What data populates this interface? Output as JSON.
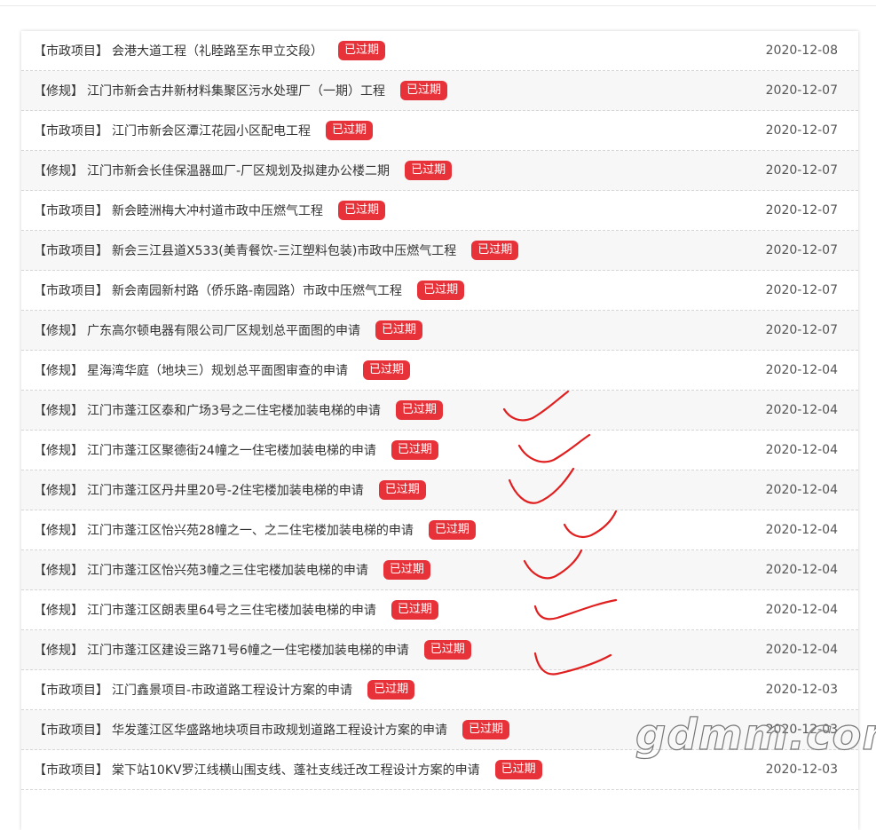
{
  "status_badge": "已过期",
  "watermark_text": "gdmm.com",
  "rows": [
    {
      "category": "【市政项目】",
      "title": "会港大道工程（礼睦路至东甲立交段）",
      "date": "2020-12-08"
    },
    {
      "category": "【修规】",
      "title": "江门市新会古井新材料集聚区污水处理厂（一期）工程",
      "date": "2020-12-07"
    },
    {
      "category": "【市政项目】",
      "title": "江门市新会区潭江花园小区配电工程",
      "date": "2020-12-07"
    },
    {
      "category": "【修规】",
      "title": "江门市新会长佳保温器皿厂-厂区规划及拟建办公楼二期",
      "date": "2020-12-07"
    },
    {
      "category": "【市政项目】",
      "title": "新会睦洲梅大冲村道市政中压燃气工程",
      "date": "2020-12-07"
    },
    {
      "category": "【市政项目】",
      "title": "新会三江县道X533(美青餐饮-三江塑料包装)市政中压燃气工程",
      "date": "2020-12-07"
    },
    {
      "category": "【市政项目】",
      "title": "新会南园新村路（侨乐路-南园路）市政中压燃气工程",
      "date": "2020-12-07"
    },
    {
      "category": "【修规】",
      "title": "广东高尔顿电器有限公司厂区规划总平面图的申请",
      "date": "2020-12-07"
    },
    {
      "category": "【修规】",
      "title": "星海湾华庭（地块三）规划总平面图审查的申请",
      "date": "2020-12-04"
    },
    {
      "category": "【修规】",
      "title": "江门市蓬江区泰和广场3号之二住宅楼加装电梯的申请",
      "date": "2020-12-04"
    },
    {
      "category": "【修规】",
      "title": "江门市蓬江区聚德街24幢之一住宅楼加装电梯的申请",
      "date": "2020-12-04"
    },
    {
      "category": "【修规】",
      "title": "江门市蓬江区丹井里20号-2住宅楼加装电梯的申请",
      "date": "2020-12-04"
    },
    {
      "category": "【修规】",
      "title": "江门市蓬江区怡兴苑28幢之一、之二住宅楼加装电梯的申请",
      "date": "2020-12-04"
    },
    {
      "category": "【修规】",
      "title": "江门市蓬江区怡兴苑3幢之三住宅楼加装电梯的申请",
      "date": "2020-12-04"
    },
    {
      "category": "【修规】",
      "title": "江门市蓬江区朗表里64号之三住宅楼加装电梯的申请",
      "date": "2020-12-04"
    },
    {
      "category": "【修规】",
      "title": "江门市蓬江区建设三路71号6幢之一住宅楼加装电梯的申请",
      "date": "2020-12-04"
    },
    {
      "category": "【市政项目】",
      "title": "江门鑫景项目-市政道路工程设计方案的申请",
      "date": "2020-12-03"
    },
    {
      "category": "【市政项目】",
      "title": "华发蓬江区华盛路地块项目市政规划道路工程设计方案的申请",
      "date": "2020-12-03"
    },
    {
      "category": "【市政项目】",
      "title": "棠下站10KV罗江线横山围支线、蓬社支线迁改工程设计方案的申请",
      "date": "2020-12-03"
    }
  ]
}
